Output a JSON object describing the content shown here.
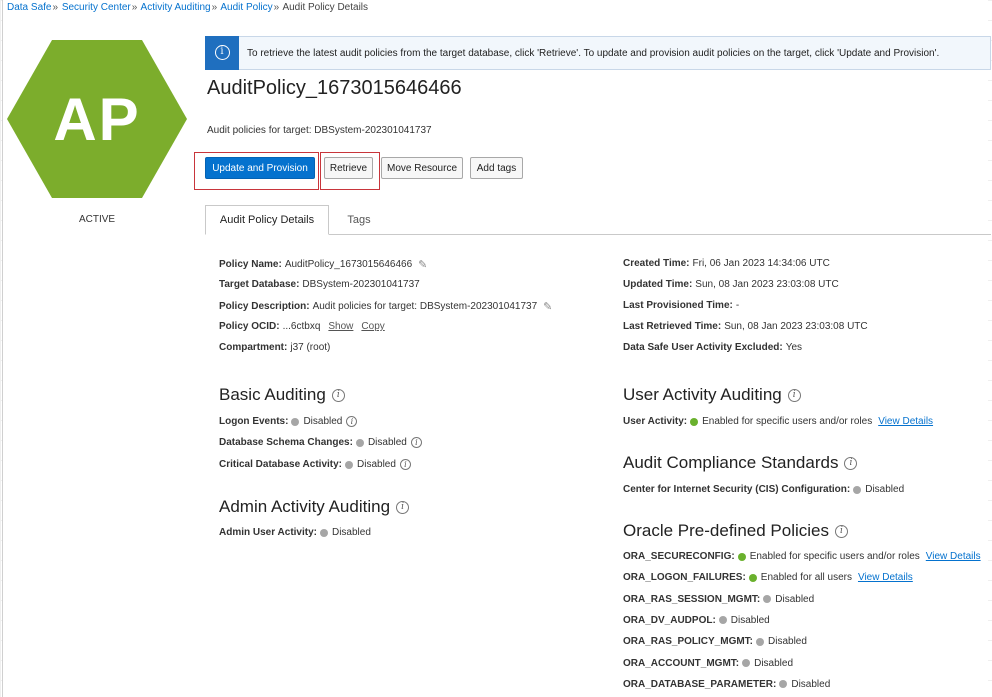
{
  "breadcrumb": {
    "items": [
      "Data Safe",
      "Security Center",
      "Activity Auditing",
      "Audit Policy"
    ],
    "current": "Audit Policy Details"
  },
  "resource": {
    "badge_text": "AP",
    "badge_color": "#7cad2c",
    "status": "ACTIVE"
  },
  "banner": {
    "icon": "info-icon",
    "message": "To retrieve the latest audit policies from the target database, click 'Retrieve'. To update and provision audit policies on the target, click 'Update and Provision'."
  },
  "header": {
    "title": "AuditPolicy_1673015646466",
    "subtitle": "Audit policies for target: DBSystem-202301041737"
  },
  "actions": {
    "update_provision": "Update and Provision",
    "retrieve": "Retrieve",
    "move_resource": "Move Resource",
    "add_tags": "Add tags"
  },
  "tabs": [
    "Audit Policy Details",
    "Tags"
  ],
  "details_left": {
    "policy_name_label": "Policy Name:",
    "policy_name": "AuditPolicy_1673015646466",
    "target_db_label": "Target Database:",
    "target_db": "DBSystem-202301041737",
    "policy_desc_label": "Policy Description:",
    "policy_desc": "Audit policies for target: DBSystem-202301041737",
    "ocid_label": "Policy OCID:",
    "ocid": "...6ctbxq",
    "ocid_show": "Show",
    "ocid_copy": "Copy",
    "compartment_label": "Compartment:",
    "compartment": "j37 (root)"
  },
  "details_right": {
    "created_label": "Created Time:",
    "created": "Fri, 06 Jan 2023 14:34:06 UTC",
    "updated_label": "Updated Time:",
    "updated": "Sun, 08 Jan 2023 23:03:08 UTC",
    "provisioned_label": "Last Provisioned Time:",
    "provisioned": "-",
    "retrieved_label": "Last Retrieved Time:",
    "retrieved": "Sun, 08 Jan 2023 23:03:08 UTC",
    "excluded_label": "Data Safe User Activity Excluded:",
    "excluded": "Yes"
  },
  "basic_auditing": {
    "title": "Basic Auditing",
    "logon_label": "Logon Events:",
    "logon": "Disabled",
    "schema_label": "Database Schema Changes:",
    "schema": "Disabled",
    "critical_label": "Critical Database Activity:",
    "critical": "Disabled"
  },
  "admin_auditing": {
    "title": "Admin Activity Auditing",
    "admin_label": "Admin User Activity:",
    "admin": "Disabled"
  },
  "user_auditing": {
    "title": "User Activity Auditing",
    "user_label": "User Activity:",
    "user": "Enabled for specific users and/or roles",
    "view": "View Details"
  },
  "compliance": {
    "title": "Audit Compliance Standards",
    "cis_label": "Center for Internet Security (CIS) Configuration:",
    "cis": "Disabled"
  },
  "predefined": {
    "title": "Oracle Pre-defined Policies",
    "items": [
      {
        "label": "ORA_SECURECONFIG:",
        "value": "Enabled for specific users and/or roles",
        "status": "green",
        "link": "View Details"
      },
      {
        "label": "ORA_LOGON_FAILURES:",
        "value": "Enabled for all users",
        "status": "green",
        "link": "View Details"
      },
      {
        "label": "ORA_RAS_SESSION_MGMT:",
        "value": "Disabled",
        "status": "grey",
        "link": ""
      },
      {
        "label": "ORA_DV_AUDPOL:",
        "value": "Disabled",
        "status": "grey",
        "link": ""
      },
      {
        "label": "ORA_RAS_POLICY_MGMT:",
        "value": "Disabled",
        "status": "grey",
        "link": ""
      },
      {
        "label": "ORA_ACCOUNT_MGMT:",
        "value": "Disabled",
        "status": "grey",
        "link": ""
      },
      {
        "label": "ORA_DATABASE_PARAMETER:",
        "value": "Disabled",
        "status": "grey",
        "link": ""
      }
    ]
  }
}
